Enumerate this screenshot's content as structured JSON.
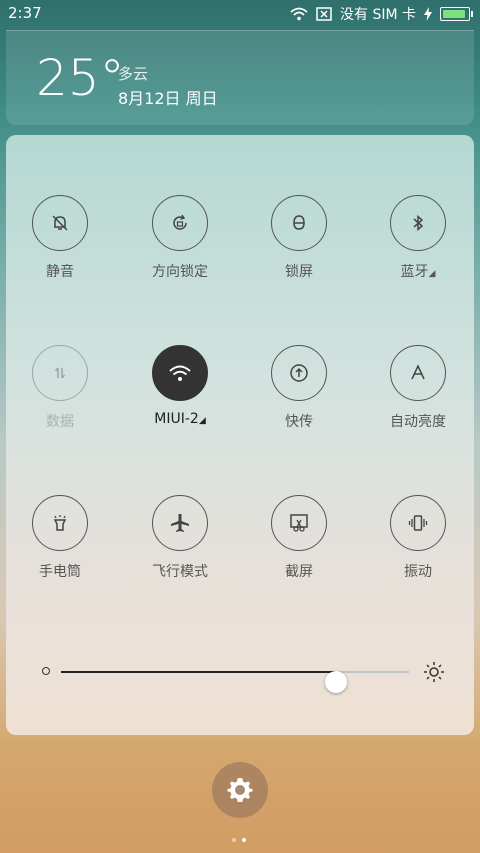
{
  "status_bar": {
    "time": "2:37",
    "no_sim": "没有 SIM 卡",
    "battery_level": 0.95
  },
  "weather": {
    "temperature": "25°",
    "condition": "多云",
    "date": "8月12日 周日"
  },
  "tiles": [
    {
      "label": "静音",
      "icon": "bell-off-icon"
    },
    {
      "label": "方向锁定",
      "icon": "rotation-lock-icon"
    },
    {
      "label": "锁屏",
      "icon": "lock-icon"
    },
    {
      "label": "蓝牙",
      "icon": "bluetooth-icon"
    },
    {
      "label": "数据",
      "icon": "mobile-data-icon"
    },
    {
      "label": "MIUI-2",
      "icon": "wifi-icon"
    },
    {
      "label": "快传",
      "icon": "upload-icon"
    },
    {
      "label": "自动亮度",
      "icon": "auto-brightness-icon"
    },
    {
      "label": "手电筒",
      "icon": "flashlight-icon"
    },
    {
      "label": "飞行模式",
      "icon": "airplane-icon"
    },
    {
      "label": "截屏",
      "icon": "screenshot-icon"
    },
    {
      "label": "振动",
      "icon": "vibrate-icon"
    }
  ],
  "brightness": {
    "level": 0.79
  },
  "settings_icon": "gear-icon",
  "pager": {
    "pages": 2,
    "current": 2
  }
}
